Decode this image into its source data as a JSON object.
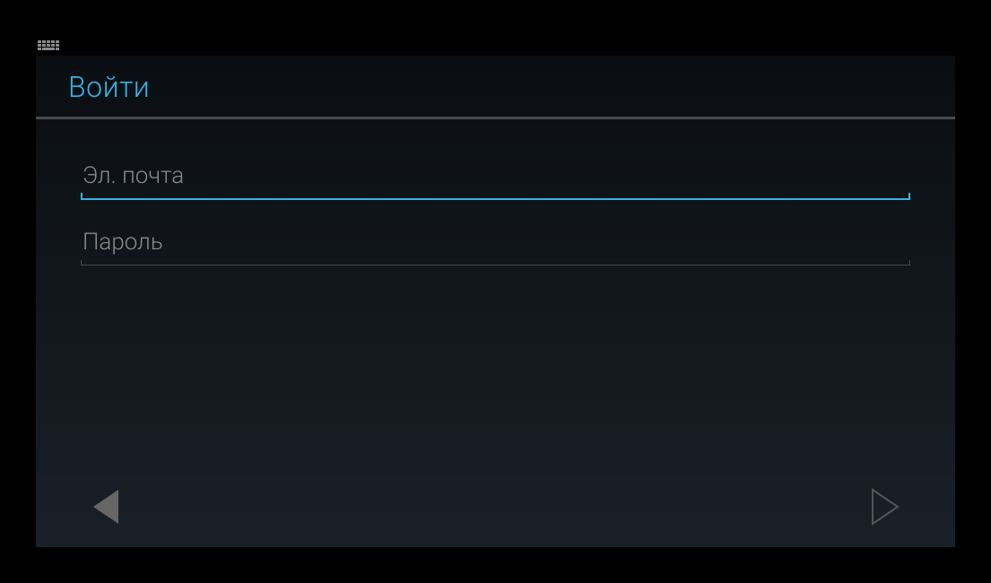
{
  "header": {
    "title": "Войти"
  },
  "form": {
    "email": {
      "placeholder": "Эл. почта",
      "value": ""
    },
    "password": {
      "placeholder": "Пароль",
      "value": ""
    }
  },
  "colors": {
    "accent": "#33b5e5",
    "placeholder": "#888888",
    "divider": "#4a4a4a"
  }
}
